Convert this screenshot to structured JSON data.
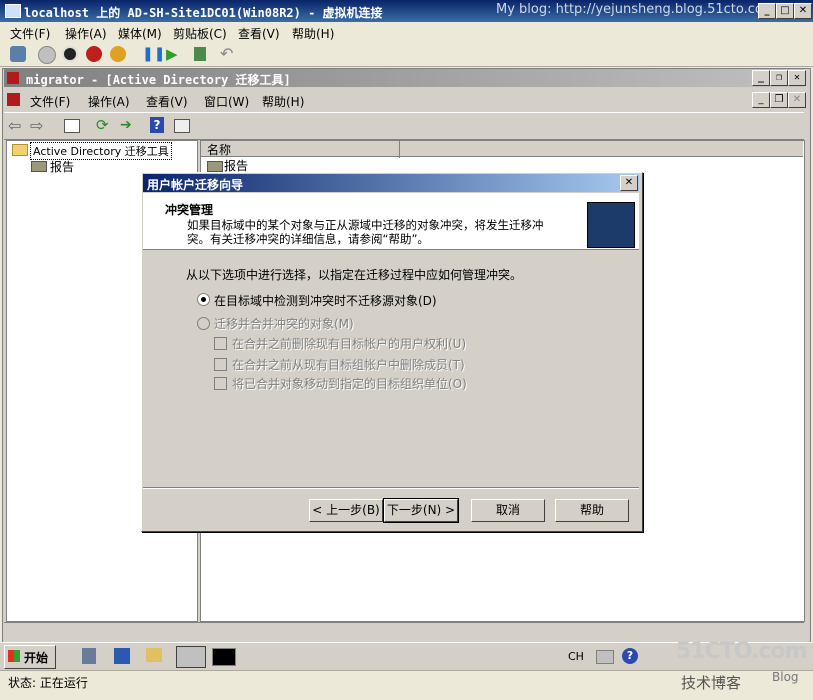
{
  "vm_window": {
    "title": "localhost 上的 AD-SH-Site1DC01(Win08R2) - 虚拟机连接",
    "watermark": "My blog: http://yejunsheng.blog.51cto.com",
    "menu": [
      "文件(F)",
      "操作(A)",
      "媒体(M)",
      "剪贴板(C)",
      "查看(V)",
      "帮助(H)"
    ]
  },
  "mmc": {
    "title": "migrator - [Active Directory 迁移工具]",
    "menu": [
      "文件(F)",
      "操作(A)",
      "查看(V)",
      "窗口(W)",
      "帮助(H)"
    ],
    "tree_root": "Active Directory 迁移工具",
    "tree_child": "报告",
    "column_header": "名称",
    "list_item": "报告"
  },
  "dialog": {
    "title": "用户帐户迁移向导",
    "heading": "冲突管理",
    "description_line1": "如果目标域中的某个对象与正从源域中迁移的对象冲突，将发生迁移冲",
    "description_line2": "突。有关迁移冲突的详细信息，请参阅“帮助”。",
    "instruction": "从以下选项中进行选择，以指定在迁移过程中应如何管理冲突。",
    "option1": "在目标域中检测到冲突时不迁移源对象(D)",
    "option2": "迁移并合并冲突的对象(M)",
    "sub1": "在合并之前删除现有目标帐户的用户权利(U)",
    "sub2": "在合并之前从现有目标组帐户中删除成员(T)",
    "sub3": "将已合并对象移动到指定的目标组织单位(O)",
    "back_button": "< 上一步(B)",
    "next_button": "下一步(N) >",
    "cancel_button": "取消",
    "help_button": "帮助"
  },
  "taskbar": {
    "start": "开始",
    "lang": "CH"
  },
  "status": {
    "text": "状态: 正在运行"
  },
  "corner_logo": {
    "main": "51CTO.com",
    "sub": "技术博客",
    "blog": "Blog"
  },
  "colors": {
    "title_blue": "#0a246a",
    "dialog_gray": "#d4d0c8"
  }
}
